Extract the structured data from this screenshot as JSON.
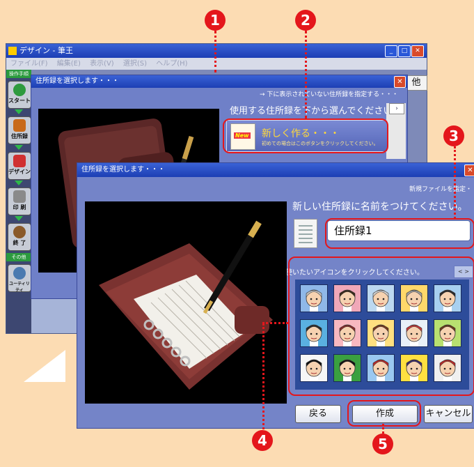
{
  "app": {
    "title": "デザイン - 筆王",
    "menu": [
      "ファイル(F)",
      "編集(E)",
      "表示(V)",
      "選択(S)",
      "ヘルプ(H)"
    ],
    "side_header": "操作手順",
    "side_other": "その他",
    "side_buttons": [
      {
        "label": "スタート",
        "icon": "start-icon",
        "color": "#2e9a3e"
      },
      {
        "label": "住所録",
        "icon": "address-book-icon",
        "color": "#c86a1a"
      },
      {
        "label": "デザイン",
        "icon": "design-icon",
        "color": "#d03030"
      },
      {
        "label": "印 刷",
        "icon": "printer-icon",
        "color": "#6a6a6a"
      },
      {
        "label": "終 了",
        "icon": "exit-icon",
        "color": "#8a5a2a"
      },
      {
        "label": "ユーティリティ",
        "icon": "utility-icon",
        "color": "#4a7ab0"
      }
    ],
    "tab_label": "他"
  },
  "dialog1": {
    "title": "住所録を選択します・・・",
    "link": "→ 下に表示されていない住所録を指定する・・・",
    "prompt": "使用する住所録を下から選んでください。",
    "new_button": {
      "badge": "New",
      "label": "新しく作る・・・",
      "sub": "初めての場合はこのボタンをクリックしてください。"
    }
  },
  "dialog2": {
    "title": "住所録を選択します・・・",
    "new_file_label": "新規ファイルを指定・",
    "prompt": "新しい住所録に名前をつけてください。",
    "name_value": "住所録1",
    "icon_prompt": "使いたいアイコンをクリックしてください。",
    "icon_scroll": "< >",
    "avatars": [
      {
        "bg": "#8fb8e8",
        "hair": "#c0c0c0",
        "skin": "#f6d2b0"
      },
      {
        "bg": "#f0a8b8",
        "hair": "#3a2a1a",
        "skin": "#f6d2b0"
      },
      {
        "bg": "#bcd8f0",
        "hair": "#d0d0d0",
        "skin": "#f6d2b0"
      },
      {
        "bg": "#ffd86a",
        "hair": "#a0a0a0",
        "skin": "#f6d2b0"
      },
      {
        "bg": "#a8d0f0",
        "hair": "#2a2a2a",
        "skin": "#f6d2b0"
      },
      {
        "bg": "#5ab0e0",
        "hair": "#2a2a2a",
        "skin": "#f6d2b0"
      },
      {
        "bg": "#f8b8c0",
        "hair": "#8a2a2a",
        "skin": "#f6d2b0"
      },
      {
        "bg": "#ffe080",
        "hair": "#7a3a1a",
        "skin": "#f6d2b0"
      },
      {
        "bg": "#e8f0f8",
        "hair": "#c83a3a",
        "skin": "#f6d2b0"
      },
      {
        "bg": "#b8e070",
        "hair": "#6a3a1a",
        "skin": "#f6d2b0"
      },
      {
        "bg": "#f6f6f6",
        "hair": "#111111",
        "skin": "#f6d2b0"
      },
      {
        "bg": "#3aa040",
        "hair": "#111111",
        "skin": "#f6d2b0"
      },
      {
        "bg": "#9ac8f0",
        "hair": "#b82a2a",
        "skin": "#f6d2b0"
      },
      {
        "bg": "#ffe040",
        "hair": "#3a2a6a",
        "skin": "#f6d2b0"
      },
      {
        "bg": "#f0f0f0",
        "hair": "#b82a2a",
        "skin": "#f6d2b0"
      }
    ],
    "buttons": {
      "back": "戻る",
      "create": "作成",
      "cancel": "キャンセル"
    }
  },
  "callouts": [
    "1",
    "2",
    "3",
    "4",
    "5"
  ],
  "accent": "#e4161b"
}
